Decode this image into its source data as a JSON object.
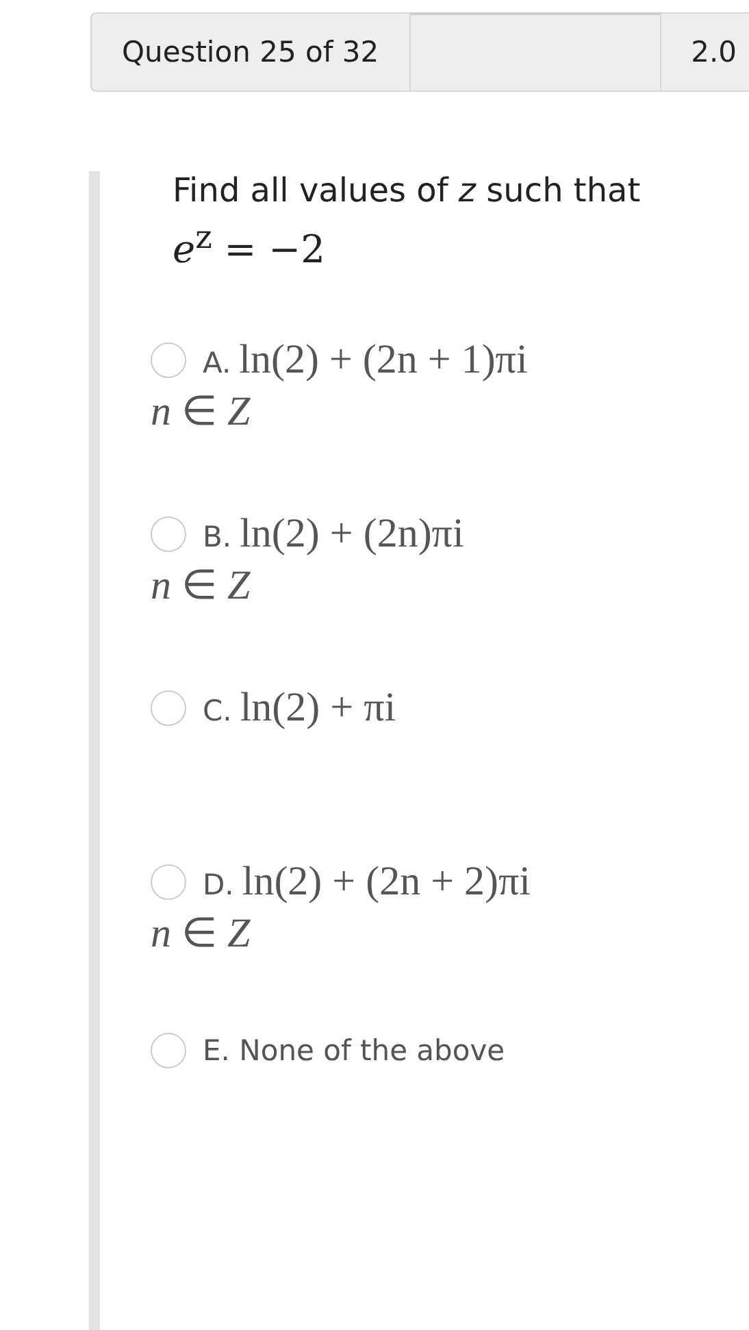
{
  "header": {
    "question_counter": "Question 25 of 32",
    "points": "2.0"
  },
  "question": {
    "prompt": "Find all values of *z* such that",
    "equation": "*e*$^{z}$ = −2"
  },
  "options": [
    {
      "kind": "math",
      "letter": "A.",
      "formula": "ln(2) + (2n + 1)πi",
      "condition": "*n* ∈ *Z*",
      "selected": false
    },
    {
      "kind": "math",
      "letter": "B.",
      "formula": "ln(2) + (2n)πi",
      "condition": "*n* ∈ *Z*",
      "selected": false
    },
    {
      "kind": "math",
      "letter": "C.",
      "formula": "ln(2) + πi",
      "selected": false
    },
    {
      "kind": "math",
      "letter": "D.",
      "formula": "ln(2) + (2n + 2)πi",
      "condition": "*n* ∈ *Z*",
      "selected": false
    },
    {
      "kind": "text",
      "letter": "E.",
      "label": "None of the above",
      "selected": false
    }
  ]
}
